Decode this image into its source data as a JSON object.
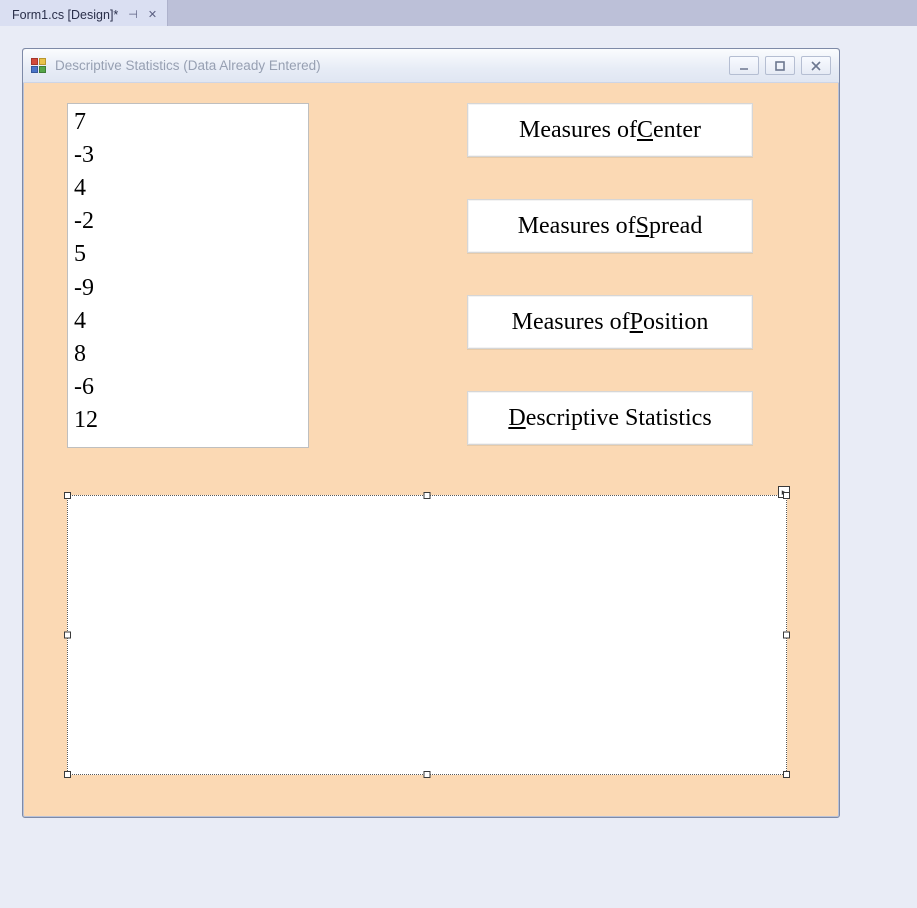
{
  "ide": {
    "tab_label": "Form1.cs [Design]*"
  },
  "form": {
    "title": "Descriptive Statistics (Data Already Entered)",
    "listbox_items": [
      "7",
      "-3",
      "4",
      "-2",
      "5",
      "-9",
      "4",
      "8",
      "-6",
      "12"
    ],
    "buttons": {
      "center": {
        "pre": "Measures of ",
        "mn": "C",
        "post": "enter"
      },
      "spread": {
        "pre": "Measures of ",
        "mn": "S",
        "post": "pread"
      },
      "position": {
        "pre": "Measures of ",
        "mn": "P",
        "post": "osition"
      },
      "desc": {
        "pre": "",
        "mn": "D",
        "post": "escriptive Statistics"
      }
    }
  }
}
